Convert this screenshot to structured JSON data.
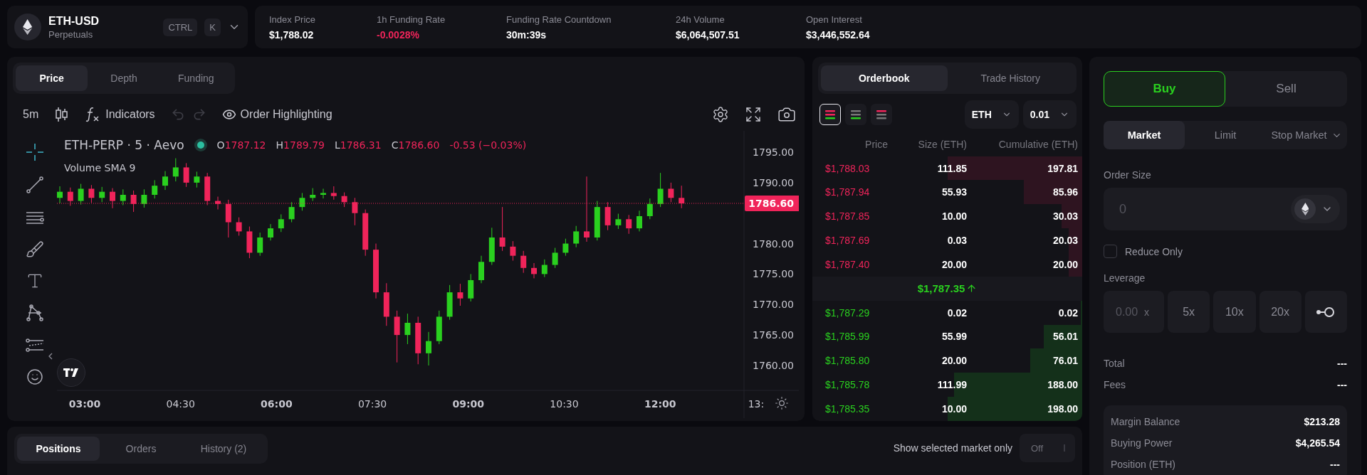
{
  "market": {
    "symbol": "ETH-USD",
    "type": "Perpetuals",
    "shortcut": [
      "CTRL",
      "K"
    ]
  },
  "stats": [
    {
      "label": "Index Price",
      "value": "$1,788.02",
      "negative": false
    },
    {
      "label": "1h Funding Rate",
      "value": "-0.0028%",
      "negative": true
    },
    {
      "label": "Funding Rate Countdown",
      "value": "30m:39s",
      "negative": false
    },
    {
      "label": "24h Volume",
      "value": "$6,064,507.51",
      "negative": false
    },
    {
      "label": "Open Interest",
      "value": "$3,446,552.64",
      "negative": false
    }
  ],
  "chart_panel": {
    "tabs": [
      {
        "label": "Price",
        "selected": true
      },
      {
        "label": "Depth",
        "selected": false
      },
      {
        "label": "Funding",
        "selected": false
      }
    ],
    "toolbar": {
      "interval": "5m",
      "indicators": "Indicators",
      "highlighting": "Order Highlighting"
    },
    "legend": {
      "title": "ETH-PERP · 5 · Aevo",
      "ohlc": [
        {
          "key": "O",
          "value": "1787.12"
        },
        {
          "key": "H",
          "value": "1789.79"
        },
        {
          "key": "L",
          "value": "1786.31"
        },
        {
          "key": "C",
          "value": "1786.60"
        }
      ],
      "change": "-0.53 (−0.03%)",
      "study": "Volume SMA 9"
    },
    "price_ticks": [
      "1795.00",
      "1790.00",
      "1780.00",
      "1775.00",
      "1770.00",
      "1765.00",
      "1760.00"
    ],
    "time_ticks": [
      {
        "label": "03:00",
        "bold": true
      },
      {
        "label": "04:30",
        "bold": false
      },
      {
        "label": "06:00",
        "bold": true
      },
      {
        "label": "07:30",
        "bold": false
      },
      {
        "label": "09:00",
        "bold": true
      },
      {
        "label": "10:30",
        "bold": false
      },
      {
        "label": "12:00",
        "bold": true
      },
      {
        "label": "13:",
        "bold": false
      }
    ],
    "last_price": "1786.60"
  },
  "orderbook": {
    "tabs": [
      {
        "label": "Orderbook",
        "selected": true
      },
      {
        "label": "Trade History",
        "selected": false
      }
    ],
    "views": [
      {
        "kind": "both",
        "selected": true
      },
      {
        "kind": "bids",
        "selected": false
      },
      {
        "kind": "asks",
        "selected": false
      }
    ],
    "asset": "ETH",
    "step": "0.01",
    "columns": [
      "Price",
      "Size (ETH)",
      "Cumulative (ETH)"
    ],
    "asks": [
      {
        "price": "$1,788.03",
        "size": "111.85",
        "total": "197.81"
      },
      {
        "price": "$1,787.94",
        "size": "55.93",
        "total": "85.96"
      },
      {
        "price": "$1,787.85",
        "size": "10.00",
        "total": "30.03"
      },
      {
        "price": "$1,787.69",
        "size": "0.03",
        "total": "20.03"
      },
      {
        "price": "$1,787.40",
        "size": "20.00",
        "total": "20.00"
      }
    ],
    "mid": {
      "price": "$1,787.35"
    },
    "bids": [
      {
        "price": "$1,787.29",
        "size": "0.02",
        "total": "0.02"
      },
      {
        "price": "$1,785.99",
        "size": "55.99",
        "total": "56.01"
      },
      {
        "price": "$1,785.80",
        "size": "20.00",
        "total": "76.01"
      },
      {
        "price": "$1,785.78",
        "size": "111.99",
        "total": "188.00"
      },
      {
        "price": "$1,785.35",
        "size": "10.00",
        "total": "198.00"
      }
    ]
  },
  "trade": {
    "sides": [
      {
        "label": "Buy",
        "kind": "buy",
        "selected": true
      },
      {
        "label": "Sell",
        "kind": "sell",
        "selected": false
      }
    ],
    "order_types": [
      {
        "label": "Market",
        "selected": true,
        "dropdown": false
      },
      {
        "label": "Limit",
        "selected": false,
        "dropdown": false
      },
      {
        "label": "Stop Market",
        "selected": false,
        "dropdown": true
      }
    ],
    "order_size": {
      "label": "Order Size",
      "placeholder": "0"
    },
    "reduce_only": {
      "label": "Reduce Only",
      "checked": false
    },
    "leverage": {
      "label": "Leverage",
      "placeholder": "0.00",
      "suffix": "x",
      "presets": [
        "5x",
        "10x",
        "20x"
      ]
    },
    "totals": [
      {
        "label": "Total",
        "value": "---"
      },
      {
        "label": "Fees",
        "value": "---"
      }
    ],
    "account": [
      {
        "label": "Margin Balance",
        "value": "$213.28"
      },
      {
        "label": "Buying Power",
        "value": "$4,265.54"
      },
      {
        "label": "Position (ETH)",
        "value": "---"
      }
    ]
  },
  "bottom": {
    "tabs": [
      {
        "label": "Positions",
        "selected": true
      },
      {
        "label": "Orders",
        "selected": false
      },
      {
        "label": "History (2)",
        "selected": false
      }
    ],
    "filter": {
      "label": "Show selected market only",
      "state": "Off",
      "on": false
    }
  }
}
